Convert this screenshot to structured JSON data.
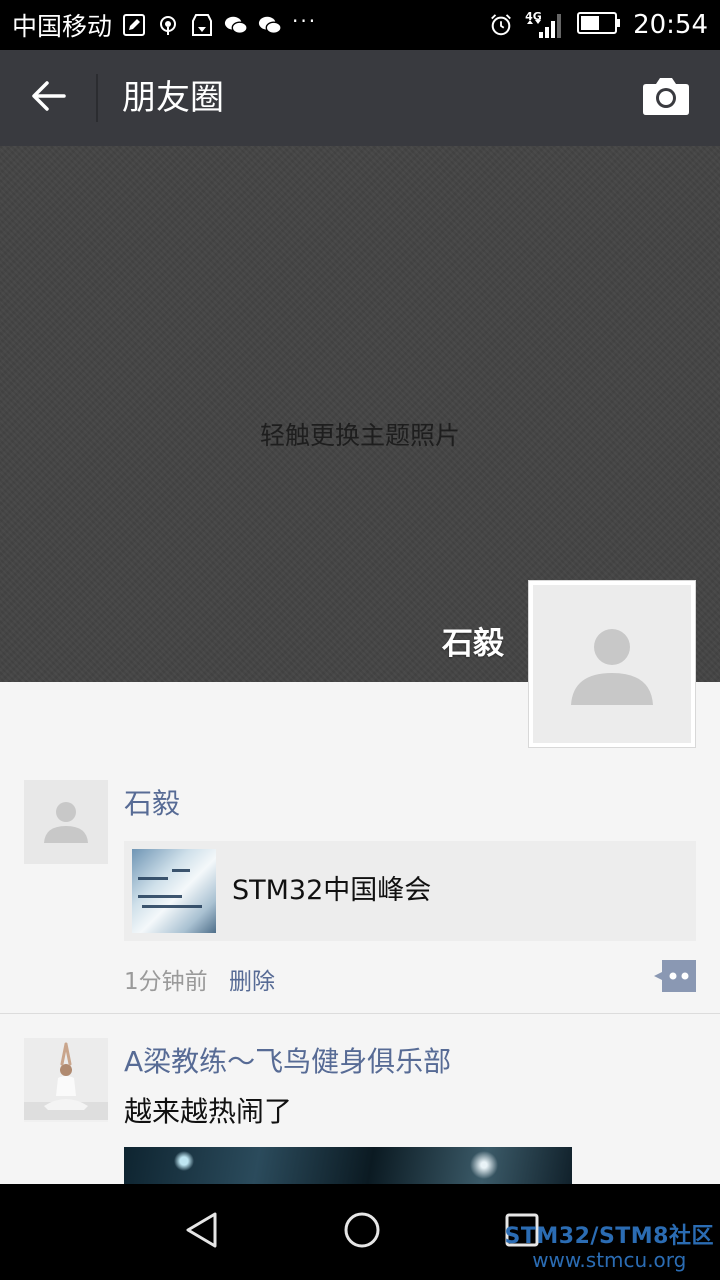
{
  "status_bar": {
    "carrier": "中国移动",
    "network": "4G",
    "time": "20:54",
    "more": "···",
    "icons": [
      "edit-icon",
      "hotspot-icon",
      "storage-icon",
      "wechat-icon",
      "wechat-icon",
      "alarm-icon",
      "signal-icon",
      "battery-icon"
    ]
  },
  "topbar": {
    "title": "朋友圈",
    "back_icon": "arrow-left-icon",
    "camera_icon": "camera-icon"
  },
  "cover": {
    "hint": "轻触更换主题照片",
    "user_name": "石毅"
  },
  "feed": [
    {
      "author": "石毅",
      "link_title": "STM32中国峰会",
      "time": "1分钟前",
      "delete_label": "删除"
    },
    {
      "author": "A梁教练～飞鸟健身俱乐部",
      "text": "越来越热闹了"
    }
  ],
  "watermark": {
    "line1": "STM32/STM8社区",
    "line2": "www.stmcu.org"
  },
  "colors": {
    "topbar": "#393a3f",
    "link": "#576b95",
    "cover": "#444444"
  }
}
